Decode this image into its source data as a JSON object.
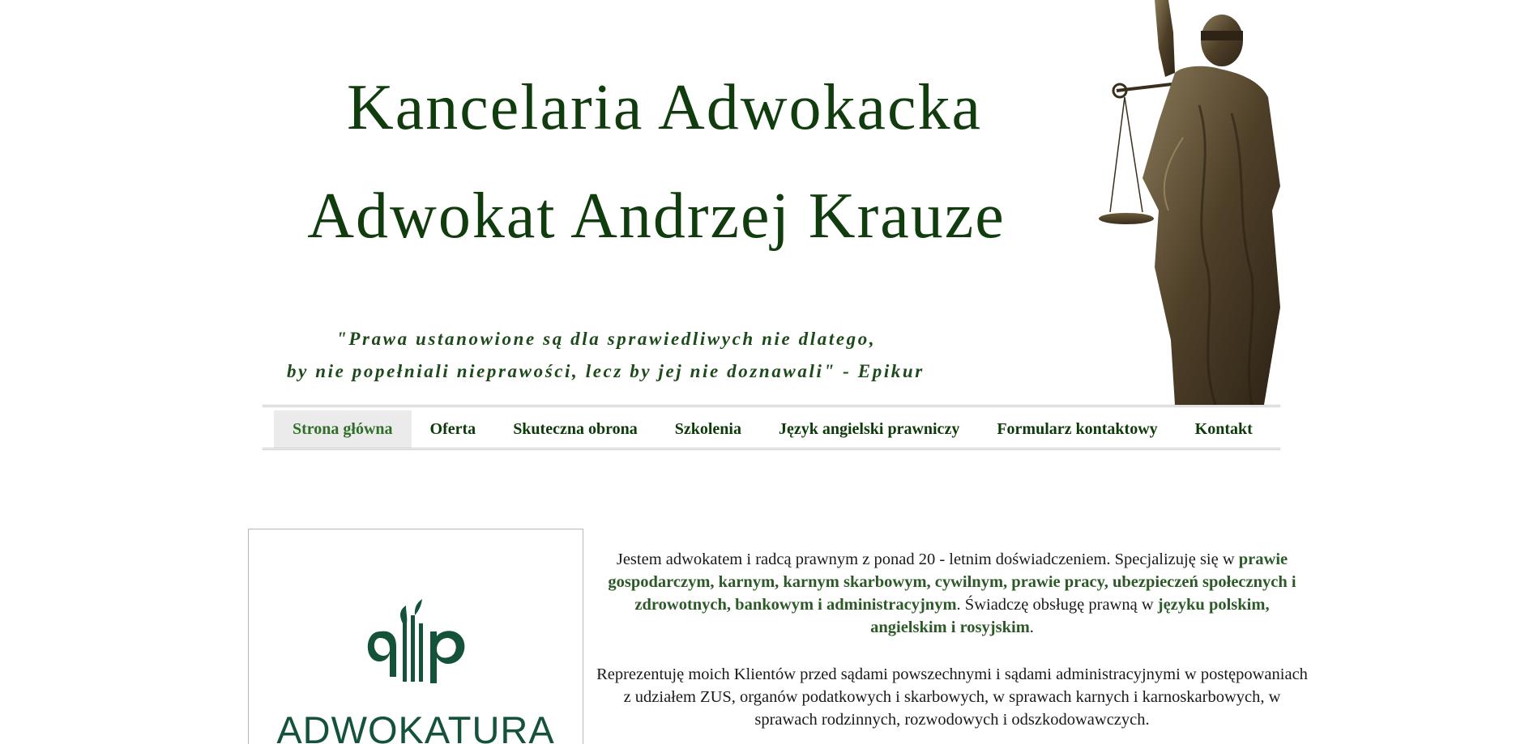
{
  "header": {
    "title_line1": "Kancelaria Adwokacka",
    "title_line2": "Adwokat Andrzej Krauze",
    "quote_line1": "\"Prawa ustanowione są dla sprawiedliwych nie dlatego,",
    "quote_line2": "by nie popełniali nieprawości, lecz by jej nie doznawali\" - Epikur"
  },
  "nav": {
    "items": [
      {
        "label": "Strona główna",
        "active": true
      },
      {
        "label": "Oferta"
      },
      {
        "label": "Skuteczna obrona"
      },
      {
        "label": "Szkolenia"
      },
      {
        "label": "Język angielski prawniczy"
      },
      {
        "label": "Formularz kontaktowy"
      },
      {
        "label": "Kontakt"
      }
    ]
  },
  "logo": {
    "text": "ADWOKATURA",
    "color": "#14523a"
  },
  "content": {
    "p1": {
      "intro": "Jestem adwokatem i radcą prawnym z ponad 20 - letnim doświadczeniem. Specjalizuję się w ",
      "areas": "prawie gospodarczym, karnym, karnym skarbowym, cywilnym, prawie pracy, ubezpieczeń społecznych i zdrowotnych, bankowym i administracyjnym",
      "mid": ". Świadczę obsługę prawną w ",
      "languages": "języku polskim, angielskim i rosyjskim",
      "end": "."
    },
    "p2": "Reprezentuję moich Klientów przed sądami powszechnymi i sądami administracyjnymi w postępowaniach z udziałem ZUS, organów podatkowych i skarbowych, w sprawach karnych i karnoskarbowych, w sprawach rodzinnych, rozwodowych i odszkodowawczych."
  },
  "colors": {
    "title": "#113c0e",
    "nav_text": "#0c3a08",
    "nav_active_text": "#2f6e28",
    "nav_active_bg": "#ebebeb",
    "highlight": "#2c5a27"
  }
}
